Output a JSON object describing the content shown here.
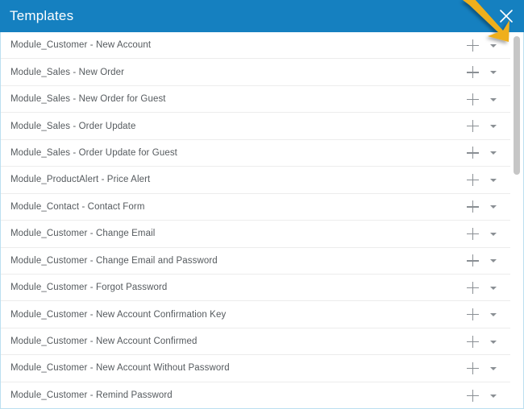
{
  "dialog": {
    "title": "Templates",
    "close_icon": "close-icon",
    "accent_color": "#1580c0",
    "border_color": "#bcdff0"
  },
  "annotation": {
    "type": "arrow",
    "color": "#efaf1a",
    "points_to": "row-caret-dropdown-icon"
  },
  "scrollbar": {
    "orientation": "vertical",
    "thumb_color": "#c6c6c6",
    "thumb_position_percent": 0,
    "thumb_size_percent": 37
  },
  "list": {
    "row_icons": {
      "add": "plus-icon",
      "dropdown": "caret-down-icon"
    },
    "items": [
      {
        "label": "Module_Customer - New Account"
      },
      {
        "label": "Module_Sales - New Order"
      },
      {
        "label": "Module_Sales - New Order for Guest"
      },
      {
        "label": "Module_Sales - Order Update"
      },
      {
        "label": "Module_Sales - Order Update for Guest"
      },
      {
        "label": "Module_ProductAlert - Price Alert"
      },
      {
        "label": "Module_Contact - Contact Form"
      },
      {
        "label": "Module_Customer - Change Email"
      },
      {
        "label": "Module_Customer - Change Email and Password"
      },
      {
        "label": "Module_Customer - Forgot Password"
      },
      {
        "label": "Module_Customer - New Account Confirmation Key"
      },
      {
        "label": "Module_Customer - New Account Confirmed"
      },
      {
        "label": "Module_Customer - New Account Without Password"
      },
      {
        "label": "Module_Customer - Remind Password"
      }
    ]
  }
}
